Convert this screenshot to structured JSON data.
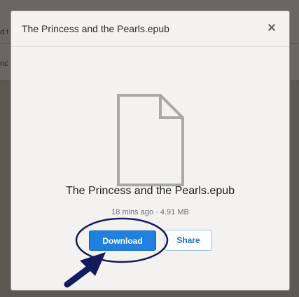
{
  "background": {
    "fragment_1": "d t",
    "fragment_2": "nc"
  },
  "dialog": {
    "title": "The Princess and the Pearls.epub",
    "close_symbol": "×",
    "file_name": "The Princess and the Pearls.epub",
    "meta": "18 mins ago · 4.91 MB",
    "download_label": "Download",
    "share_label": "Share",
    "icon": "document-icon"
  },
  "colors": {
    "accent": "#1f80e0",
    "annotation": "#141a5e"
  }
}
